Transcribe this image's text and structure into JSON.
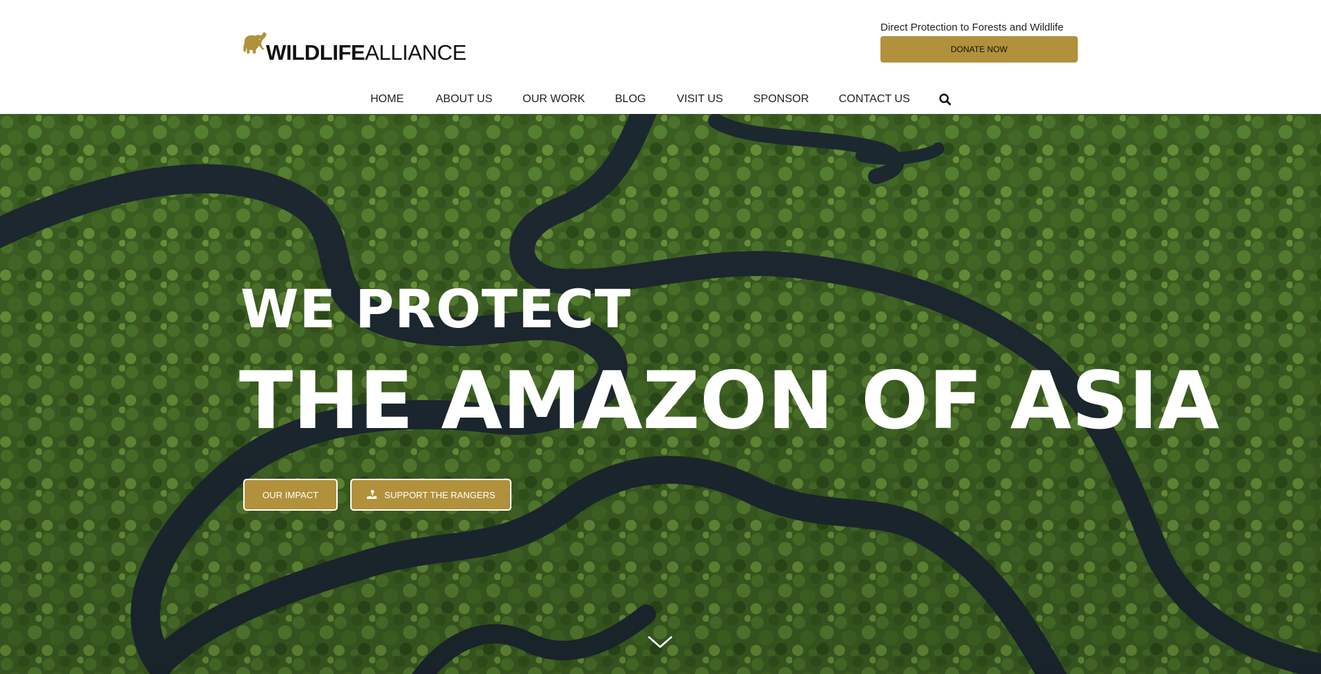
{
  "header": {
    "logo": {
      "icon": "elephant-icon",
      "text_bold": "WILDLIFE",
      "text_light": "ALLIANCE"
    },
    "tagline": "Direct Protection to Forests and Wildlife",
    "donate_label": "DONATE NOW"
  },
  "nav": {
    "items": [
      {
        "label": "HOME"
      },
      {
        "label": "ABOUT US"
      },
      {
        "label": "OUR WORK"
      },
      {
        "label": "BLOG"
      },
      {
        "label": "VISIT US"
      },
      {
        "label": "SPONSOR"
      },
      {
        "label": "CONTACT US"
      }
    ],
    "search_icon": "search-icon"
  },
  "hero": {
    "line1": "WE PROTECT",
    "line2": "THE AMAZON OF ASIA",
    "buttons": {
      "impact_label": "OUR IMPACT",
      "rangers_label": "SUPPORT THE RANGERS",
      "rangers_icon": "hand-holding-icon"
    },
    "scroll_icon": "chevron-down-icon"
  },
  "colors": {
    "accent": "#b1913b",
    "forest": "#3c5d22",
    "river": "#1f2a33",
    "text_dark": "#222222",
    "white": "#ffffff"
  }
}
